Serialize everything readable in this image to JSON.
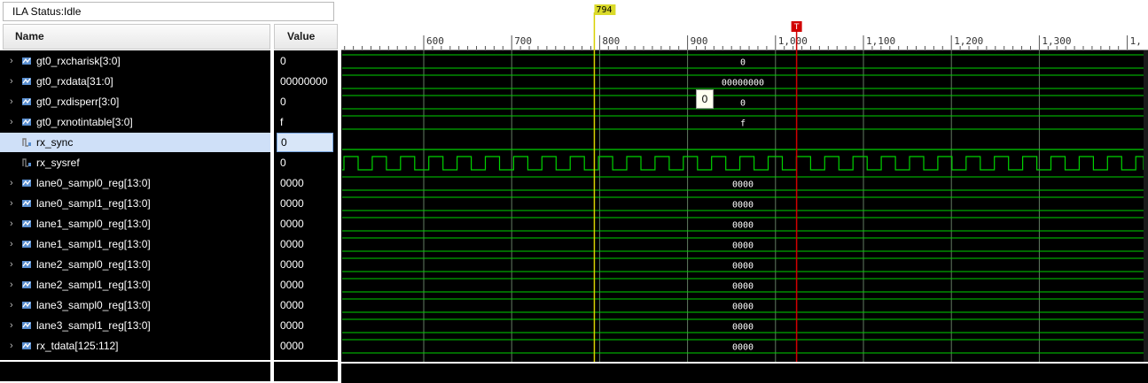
{
  "status": {
    "label": "ILA Status:Idle"
  },
  "columns": {
    "name": "Name",
    "value": "Value"
  },
  "signals": [
    {
      "name": "gt0_rxcharisk[3:0]",
      "value": "0",
      "wave": "0",
      "type": "bus",
      "expandable": true
    },
    {
      "name": "gt0_rxdata[31:0]",
      "value": "00000000",
      "wave": "00000000",
      "type": "bus",
      "expandable": true
    },
    {
      "name": "gt0_rxdisperr[3:0]",
      "value": "0",
      "wave": "0",
      "type": "bus",
      "expandable": true
    },
    {
      "name": "gt0_rxnotintable[3:0]",
      "value": "f",
      "wave": "f",
      "type": "bus",
      "expandable": true
    },
    {
      "name": "rx_sync",
      "value": "0",
      "wave": "",
      "type": "bit",
      "expandable": false,
      "selected": true
    },
    {
      "name": "rx_sysref",
      "value": "0",
      "wave": "",
      "type": "clock",
      "expandable": false
    },
    {
      "name": "lane0_sampl0_reg[13:0]",
      "value": "0000",
      "wave": "0000",
      "type": "bus",
      "expandable": true
    },
    {
      "name": "lane0_sampl1_reg[13:0]",
      "value": "0000",
      "wave": "0000",
      "type": "bus",
      "expandable": true
    },
    {
      "name": "lane1_sampl0_reg[13:0]",
      "value": "0000",
      "wave": "0000",
      "type": "bus",
      "expandable": true
    },
    {
      "name": "lane1_sampl1_reg[13:0]",
      "value": "0000",
      "wave": "0000",
      "type": "bus",
      "expandable": true
    },
    {
      "name": "lane2_sampl0_reg[13:0]",
      "value": "0000",
      "wave": "0000",
      "type": "bus",
      "expandable": true
    },
    {
      "name": "lane2_sampl1_reg[13:0]",
      "value": "0000",
      "wave": "0000",
      "type": "bus",
      "expandable": true
    },
    {
      "name": "lane3_sampl0_reg[13:0]",
      "value": "0000",
      "wave": "0000",
      "type": "bus",
      "expandable": true
    },
    {
      "name": "lane3_sampl1_reg[13:0]",
      "value": "0000",
      "wave": "0000",
      "type": "bus",
      "expandable": true
    },
    {
      "name": "rx_tdata[125:112]",
      "value": "0000",
      "wave": "0000",
      "type": "bus",
      "expandable": true
    }
  ],
  "timeline": {
    "ticks": [
      "600",
      "700",
      "800",
      "900",
      "1,000",
      "1,100",
      "1,200",
      "1,300",
      "1,"
    ],
    "cursor_label": "794",
    "trigger_label": "T",
    "hover_value": "0"
  },
  "colors": {
    "wave": "#00d200",
    "grid": "#9ccc9c",
    "cursor": "#d8d000",
    "trigger": "#d10000"
  },
  "icons": {
    "expand": "chevron-right-icon",
    "bus": "bus-signal-icon",
    "bit": "bit-signal-icon"
  }
}
